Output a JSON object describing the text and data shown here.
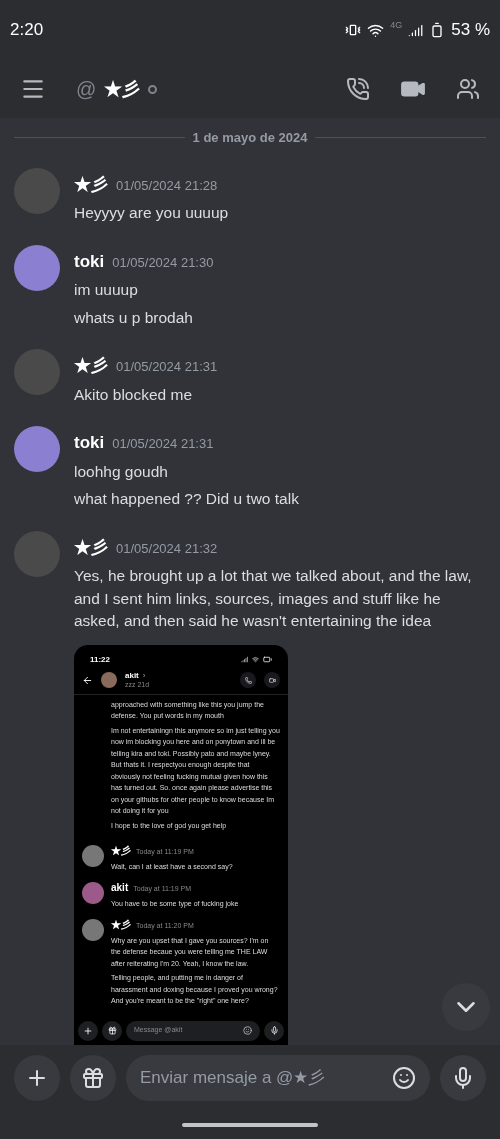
{
  "status_bar": {
    "time": "2:20",
    "network": "4G",
    "battery": "53 %"
  },
  "header": {
    "at_sign": "@",
    "title": "★彡"
  },
  "date_divider": "1 de mayo de 2024",
  "messages": [
    {
      "author": "★彡",
      "timestamp": "01/05/2024 21:28",
      "lines": [
        "Heyyyy are you uuuup"
      ]
    },
    {
      "author": "toki",
      "timestamp": "01/05/2024 21:30",
      "lines": [
        "im uuuup",
        "whats u p brodah"
      ]
    },
    {
      "author": "★彡",
      "timestamp": "01/05/2024 21:31",
      "lines": [
        "Akito blocked me"
      ]
    },
    {
      "author": "toki",
      "timestamp": "01/05/2024 21:31",
      "lines": [
        "loohhg goudh",
        "what happened ?? Did u two talk"
      ]
    },
    {
      "author": "★彡",
      "timestamp": "01/05/2024 21:32",
      "lines": [
        "Yes, he brought up a lot that we talked about, and the law, and I sent him links, sources, images and stuff like he asked, and then said he wasn't entertaining the idea"
      ],
      "attachment": {
        "time": "11:22",
        "name": "akit",
        "chevron": "›",
        "subtitle": "zzz 21d",
        "continued": [
          "approached with something like this you jump the defense. You put words in my mouth",
          "Im not entertainingn this anymore so im just telling you now im blocking you here and on ponytown and ill be telling kira and toki. Possibly pato and maybe lyney. But thats it. I respectyou enough  despite that obviously not feeling fucking mutual given how this has turned out. So. once again please advertise this on your githubs  for other people to know because Im not doing it for you",
          "I hope to the love of god you get help"
        ],
        "messages": [
          {
            "author": "★彡",
            "timestamp": "Today at 11:19 PM",
            "lines": [
              "Wait, can I at least have a second say?"
            ]
          },
          {
            "author": "akit",
            "timestamp": "Today at 11:19 PM",
            "lines": [
              "You have to be some type of fucking joke"
            ]
          },
          {
            "author": "★彡",
            "timestamp": "Today at 11:20 PM",
            "lines": [
              "Why are you upset that I gave you sources? I'm on the defense becaue you were telling me THE LAW after reiterating I'm 20. Yeah, I know the law.",
              "Telling people, and putting me in danger of harassment and doxing because I proved you wrong? And you're meant to be the \"right\" one here?"
            ]
          }
        ],
        "placeholder": "Message @akit"
      }
    }
  ],
  "composer": {
    "placeholder": "Enviar mensaje a @★彡"
  }
}
